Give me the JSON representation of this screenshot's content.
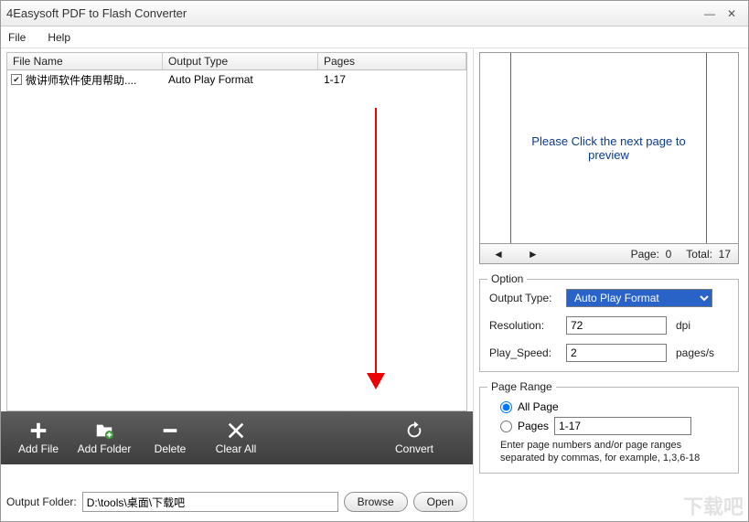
{
  "window": {
    "title": "4Easysoft PDF to Flash Converter"
  },
  "menu": {
    "file": "File",
    "help": "Help"
  },
  "table": {
    "headers": {
      "filename": "File Name",
      "output_type": "Output Type",
      "pages": "Pages"
    },
    "rows": [
      {
        "checked": true,
        "filename": "微讲师软件使用帮助....",
        "output_type": "Auto Play Format",
        "pages": "1-17"
      }
    ]
  },
  "toolbar": {
    "add_file": "Add File",
    "add_folder": "Add Folder",
    "delete": "Delete",
    "clear_all": "Clear All",
    "convert": "Convert"
  },
  "output_folder": {
    "label": "Output Folder:",
    "value": "D:\\tools\\桌面\\下载吧",
    "browse": "Browse",
    "open": "Open"
  },
  "preview": {
    "message": "Please Click the next page to preview",
    "page_label": "Page:",
    "page_value": "0",
    "total_label": "Total:",
    "total_value": "17"
  },
  "option": {
    "legend": "Option",
    "output_type_label": "Output Type:",
    "output_type_value": "Auto Play Format",
    "resolution_label": "Resolution:",
    "resolution_value": "72",
    "resolution_unit": "dpi",
    "play_speed_label": "Play_Speed:",
    "play_speed_value": "2",
    "play_speed_unit": "pages/s"
  },
  "page_range": {
    "legend": "Page Range",
    "all_label": "All Page",
    "pages_label": "Pages",
    "pages_value": "1-17",
    "selected": "all",
    "hint": "Enter page numbers and/or page ranges separated by commas, for example, 1,3,6-18"
  },
  "watermark": "下载吧"
}
